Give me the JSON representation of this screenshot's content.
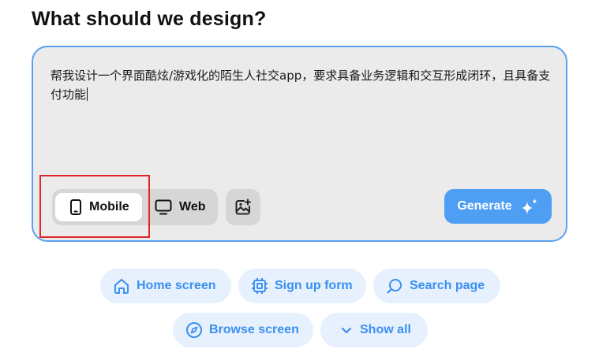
{
  "heading": "What should we design?",
  "prompt": {
    "value": "帮我设计一个界面酷炫/游戏化的陌生人社交app，要求具备业务逻辑和交互形成闭环，且具备支付功能"
  },
  "device_toggle": {
    "mobile_label": "Mobile",
    "web_label": "Web",
    "selected": "Mobile"
  },
  "generate_label": "Generate",
  "suggestions": [
    {
      "label": "Home screen",
      "icon": "home-icon"
    },
    {
      "label": "Sign up form",
      "icon": "form-icon"
    },
    {
      "label": "Search page",
      "icon": "search-icon"
    },
    {
      "label": "Browse screen",
      "icon": "compass-icon"
    },
    {
      "label": "Show all",
      "icon": "chevron-down-icon"
    }
  ],
  "colors": {
    "accent": "#4e9ef4",
    "chip_bg": "#e6f1fd",
    "chip_text": "#3b8ff0",
    "prompt_border": "#5aa2f0",
    "highlight": "#e0262a"
  }
}
